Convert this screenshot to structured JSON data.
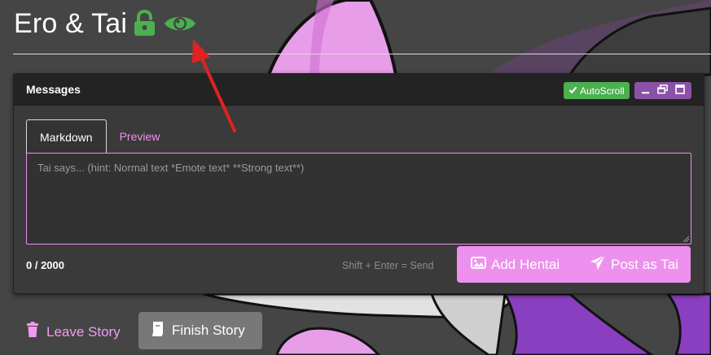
{
  "page": {
    "title": "Ero & Tai",
    "icons": {
      "lock": "unlock-icon",
      "eye": "eye-icon"
    },
    "accent_colors": {
      "green": "#4caf50",
      "pink": "#ee90ee",
      "purple": "#8a52a6"
    }
  },
  "panel": {
    "title": "Messages",
    "autoscroll_label": "AutoScroll",
    "window_controls": [
      "minimize-icon",
      "restore-icon",
      "maximize-icon"
    ]
  },
  "editor": {
    "tabs": [
      {
        "label": "Markdown",
        "active": true
      },
      {
        "label": "Preview",
        "active": false
      }
    ],
    "placeholder": "Tai says... (hint: Normal text *Emote text* **Strong text**)",
    "counter": "0 / 2000",
    "send_hint": "Shift + Enter = Send"
  },
  "actions": {
    "add_label": "Add Hentai",
    "post_label": "Post as Tai",
    "leave_label": "Leave Story",
    "finish_label": "Finish Story"
  }
}
